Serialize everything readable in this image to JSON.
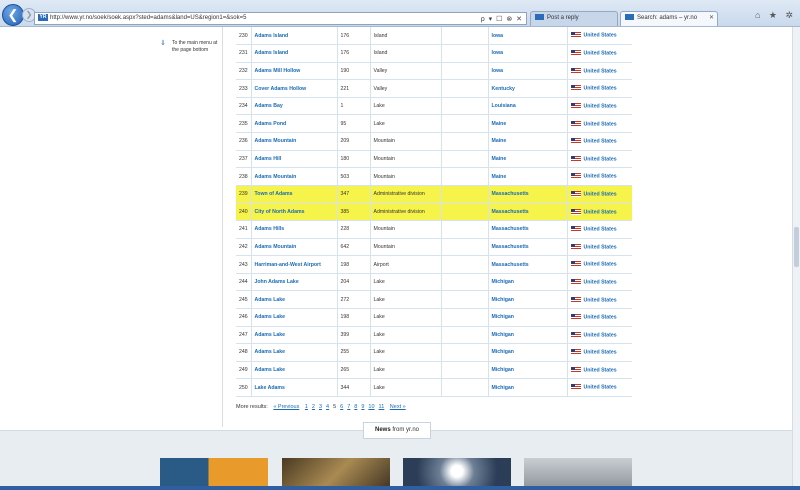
{
  "browser": {
    "url": "http://www.yr.no/soek/soek.aspx?sted=adams&land=US&region1=&sok=5",
    "site_icon_text": "YR",
    "address_actions": "ρ ▾ ☐ ⊗ ✕",
    "tabs": [
      {
        "label": "Post a reply",
        "active": false
      },
      {
        "label": "Search: adams – yr.no",
        "active": true
      }
    ],
    "right_icons": "⌂ ★ ✲"
  },
  "sidebar": {
    "main_menu_text": "To the main menu at the page bottom"
  },
  "results": [
    {
      "num": "230",
      "name": "Adams Island",
      "elev": "176",
      "type": "Island",
      "state": "Iowa",
      "country": "United States",
      "highlight": false
    },
    {
      "num": "231",
      "name": "Adams Island",
      "elev": "176",
      "type": "Island",
      "state": "Iowa",
      "country": "United States",
      "highlight": false
    },
    {
      "num": "232",
      "name": "Adams Mill Hollow",
      "elev": "190",
      "type": "Valley",
      "state": "Iowa",
      "country": "United States",
      "highlight": false
    },
    {
      "num": "233",
      "name": "Cover Adams Hollow",
      "elev": "221",
      "type": "Valley",
      "state": "Kentucky",
      "country": "United States",
      "highlight": false
    },
    {
      "num": "234",
      "name": "Adams Bay",
      "elev": "1",
      "type": "Lake",
      "state": "Louisiana",
      "country": "United States",
      "highlight": false
    },
    {
      "num": "235",
      "name": "Adams Pond",
      "elev": "95",
      "type": "Lake",
      "state": "Maine",
      "country": "United States",
      "highlight": false
    },
    {
      "num": "236",
      "name": "Adams Mountain",
      "elev": "209",
      "type": "Mountain",
      "state": "Maine",
      "country": "United States",
      "highlight": false
    },
    {
      "num": "237",
      "name": "Adams Hill",
      "elev": "180",
      "type": "Mountain",
      "state": "Maine",
      "country": "United States",
      "highlight": false
    },
    {
      "num": "238",
      "name": "Adams Mountain",
      "elev": "503",
      "type": "Mountain",
      "state": "Maine",
      "country": "United States",
      "highlight": false
    },
    {
      "num": "239",
      "name": "Town of Adams",
      "elev": "347",
      "type": "Administrative division",
      "state": "Massachusetts",
      "country": "United States",
      "highlight": true
    },
    {
      "num": "240",
      "name": "City of North Adams",
      "elev": "385",
      "type": "Administrative division",
      "state": "Massachusetts",
      "country": "United States",
      "highlight": true
    },
    {
      "num": "241",
      "name": "Adams Hills",
      "elev": "228",
      "type": "Mountain",
      "state": "Massachusetts",
      "country": "United States",
      "highlight": false
    },
    {
      "num": "242",
      "name": "Adams Mountain",
      "elev": "642",
      "type": "Mountain",
      "state": "Massachusetts",
      "country": "United States",
      "highlight": false
    },
    {
      "num": "243",
      "name": "Harriman-and-West Airport",
      "elev": "198",
      "type": "Airport",
      "state": "Massachusetts",
      "country": "United States",
      "highlight": false
    },
    {
      "num": "244",
      "name": "John Adams Lake",
      "elev": "204",
      "type": "Lake",
      "state": "Michigan",
      "country": "United States",
      "highlight": false
    },
    {
      "num": "245",
      "name": "Adams Lake",
      "elev": "272",
      "type": "Lake",
      "state": "Michigan",
      "country": "United States",
      "highlight": false
    },
    {
      "num": "246",
      "name": "Adams Lake",
      "elev": "198",
      "type": "Lake",
      "state": "Michigan",
      "country": "United States",
      "highlight": false
    },
    {
      "num": "247",
      "name": "Adams Lake",
      "elev": "399",
      "type": "Lake",
      "state": "Michigan",
      "country": "United States",
      "highlight": false
    },
    {
      "num": "248",
      "name": "Adams Lake",
      "elev": "255",
      "type": "Lake",
      "state": "Michigan",
      "country": "United States",
      "highlight": false
    },
    {
      "num": "249",
      "name": "Adams Lake",
      "elev": "265",
      "type": "Lake",
      "state": "Michigan",
      "country": "United States",
      "highlight": false
    },
    {
      "num": "250",
      "name": "Lake Adams",
      "elev": "344",
      "type": "Lake",
      "state": "Michigan",
      "country": "United States",
      "highlight": false
    }
  ],
  "pager": {
    "label": "More results:",
    "previous": "« Previous",
    "pages": [
      "1",
      "2",
      "3",
      "4",
      "5",
      "6",
      "7",
      "8",
      "9",
      "10",
      "11"
    ],
    "current": "5",
    "next": "Next »"
  },
  "news": {
    "title_bold": "News",
    "title_rest": " from yr.no"
  },
  "colors": {
    "highlight": "#f6f34b",
    "link": "#1a6bb5"
  }
}
